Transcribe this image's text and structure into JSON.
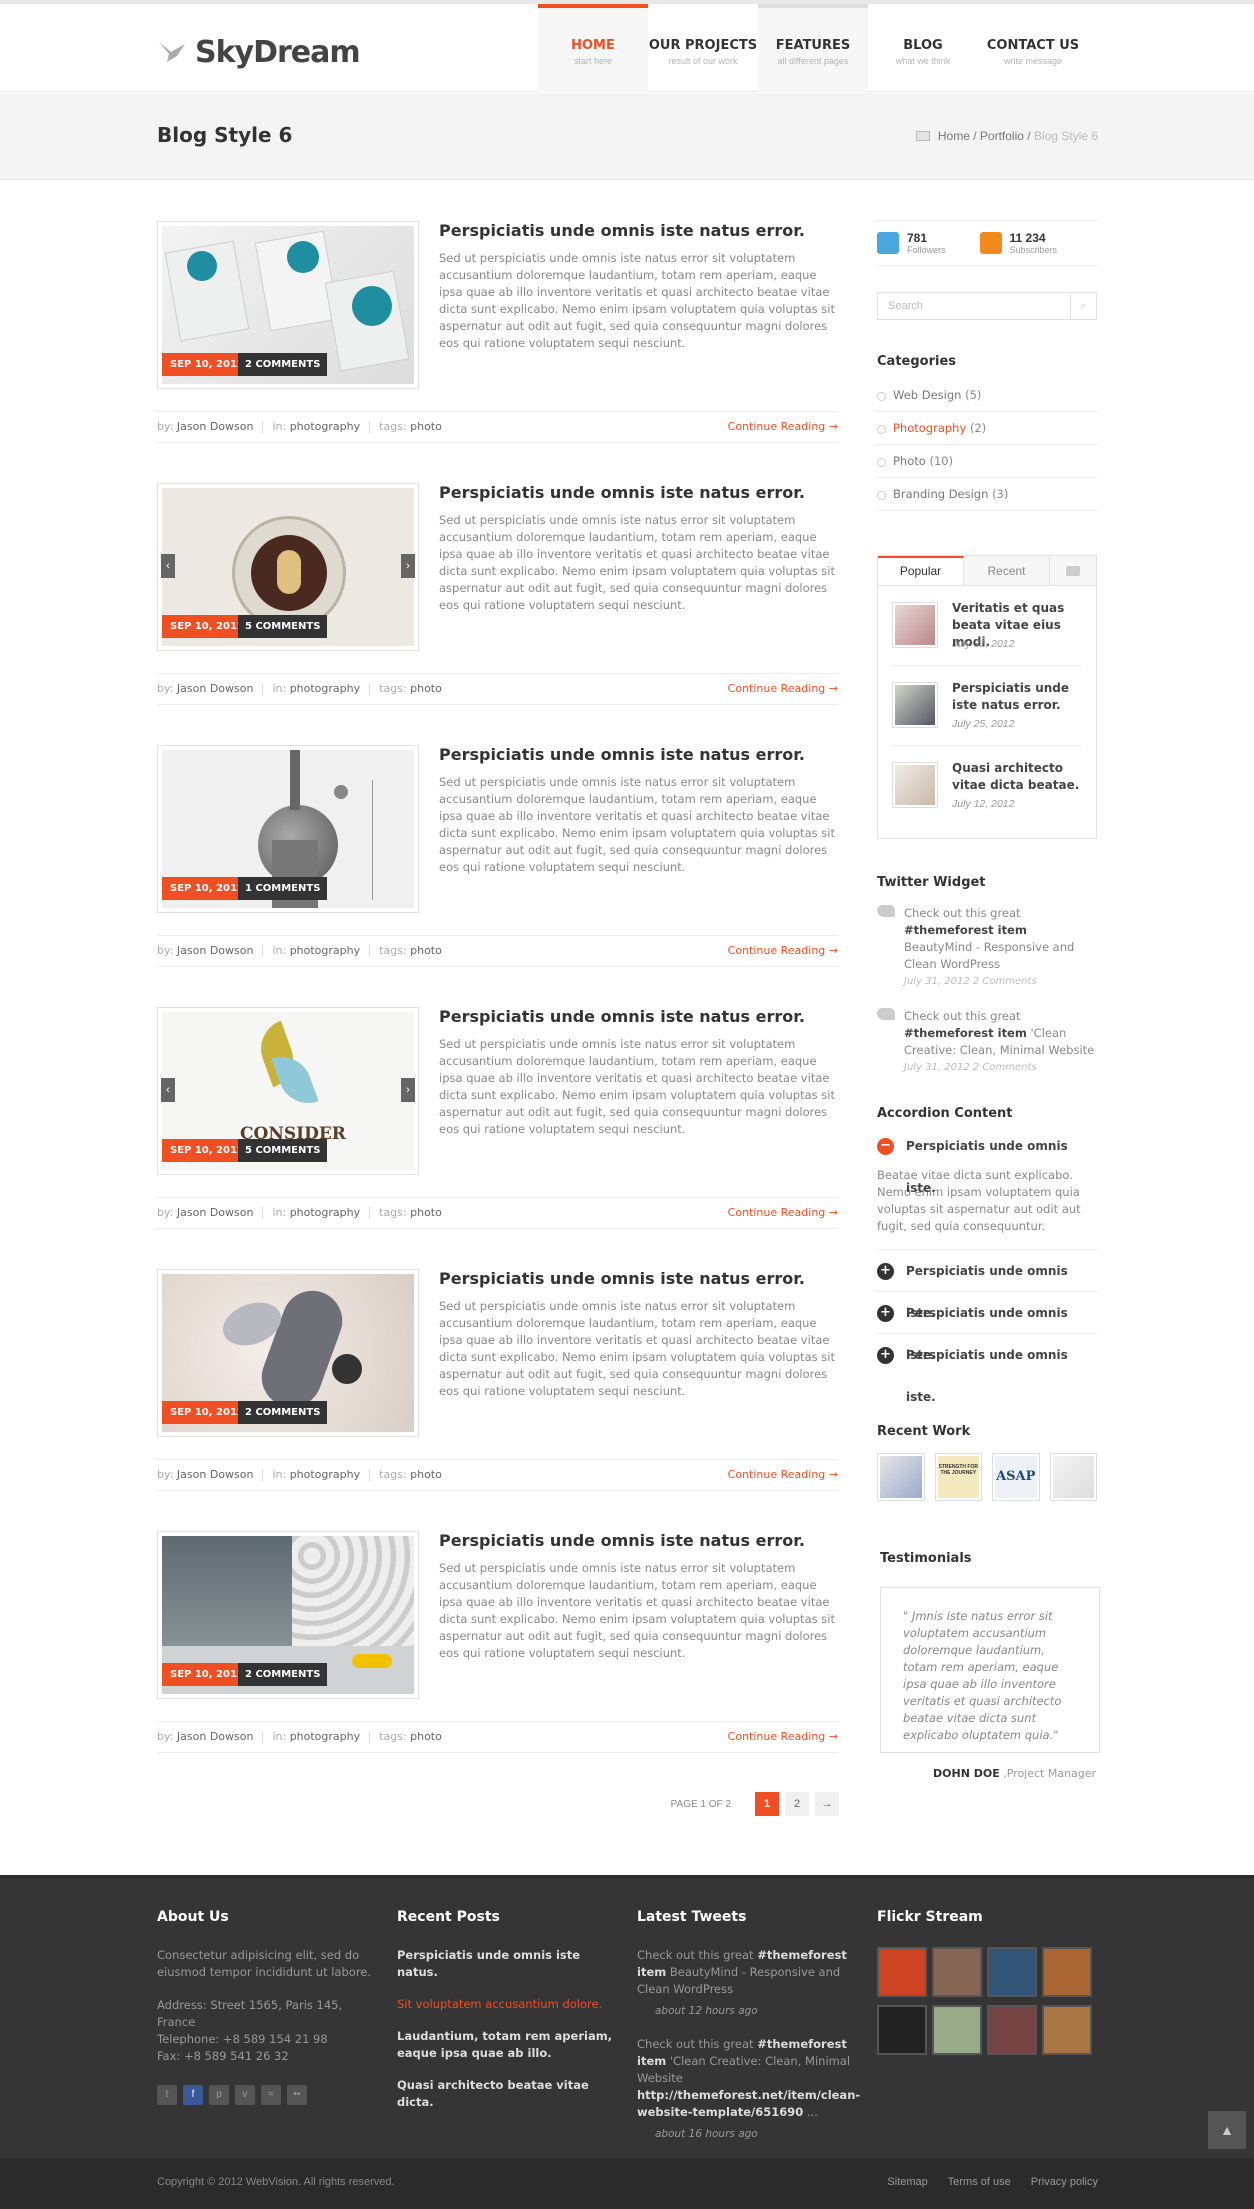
{
  "header": {
    "logo_text": "SkyDream",
    "nav": [
      {
        "label": "HOME",
        "sub": "start here"
      },
      {
        "label": "OUR PROJECTS",
        "sub": "result of our work"
      },
      {
        "label": "FEATURES",
        "sub": "all different pages"
      },
      {
        "label": "BLOG",
        "sub": "what we think"
      },
      {
        "label": "CONTACT US",
        "sub": "write message"
      }
    ]
  },
  "titlebar": {
    "title": "Blog Style 6",
    "crumb_home": "Home",
    "crumb_sep1": " / ",
    "crumb_portfolio": "Portfolio",
    "crumb_sep2": " / ",
    "crumb_current": "Blog Style 6"
  },
  "posts": [
    {
      "title": "Perspiciatis unde omnis iste natus error.",
      "date": "SEP 10, 2012",
      "comments": "2 COMMENTS",
      "text": "Sed ut perspiciatis unde omnis iste natus error sit voluptatem accusantium doloremque laudantium, totam rem aperiam, eaque ipsa quae ab illo inventore veritatis et quasi architecto beatae vitae dicta sunt explicabo. Nemo enim ipsam voluptatem quia voluptas sit aspernatur aut odit aut fugit, sed quia consequuntur magni dolores eos qui ratione voluptatem sequi nesciunt.",
      "author": "Jason Dowson",
      "category": "photography",
      "tag": "photo"
    },
    {
      "title": "Perspiciatis unde omnis iste natus error.",
      "date": "SEP 10, 2012",
      "comments": "5 COMMENTS",
      "text": "Sed ut perspiciatis unde omnis iste natus error sit voluptatem accusantium doloremque laudantium, totam rem aperiam, eaque ipsa quae ab illo inventore veritatis et quasi architecto beatae vitae dicta sunt explicabo. Nemo enim ipsam voluptatem quia voluptas sit aspernatur aut odit aut fugit, sed quia consequuntur magni dolores eos qui ratione voluptatem sequi nesciunt.",
      "author": "Jason Dowson",
      "category": "photography",
      "tag": "photo"
    },
    {
      "title": "Perspiciatis unde omnis iste natus error.",
      "date": "SEP 10, 2012",
      "comments": "1 COMMENTS",
      "text": "Sed ut perspiciatis unde omnis iste natus error sit voluptatem accusantium doloremque laudantium, totam rem aperiam, eaque ipsa quae ab illo inventore veritatis et quasi architecto beatae vitae dicta sunt explicabo. Nemo enim ipsam voluptatem quia voluptas sit aspernatur aut odit aut fugit, sed quia consequuntur magni dolores eos qui ratione voluptatem sequi nesciunt.",
      "author": "Jason Dowson",
      "category": "photography",
      "tag": "photo"
    },
    {
      "title": "Perspiciatis unde omnis iste natus error.",
      "date": "SEP 10, 2012",
      "comments": "5 COMMENTS",
      "text": "Sed ut perspiciatis unde omnis iste natus error sit voluptatem accusantium doloremque laudantium, totam rem aperiam, eaque ipsa quae ab illo inventore veritatis et quasi architecto beatae vitae dicta sunt explicabo. Nemo enim ipsam voluptatem quia voluptas sit aspernatur aut odit aut fugit, sed quia consequuntur magni dolores eos qui ratione voluptatem sequi nesciunt.",
      "author": "Jason Dowson",
      "category": "photography",
      "tag": "photo",
      "image_text": "CONSIDER"
    },
    {
      "title": "Perspiciatis unde omnis iste natus error.",
      "date": "SEP 10, 2012",
      "comments": "2 COMMENTS",
      "text": "Sed ut perspiciatis unde omnis iste natus error sit voluptatem accusantium doloremque laudantium, totam rem aperiam, eaque ipsa quae ab illo inventore veritatis et quasi architecto beatae vitae dicta sunt explicabo. Nemo enim ipsam voluptatem quia voluptas sit aspernatur aut odit aut fugit, sed quia consequuntur magni dolores eos qui ratione voluptatem sequi nesciunt.",
      "author": "Jason Dowson",
      "category": "photography",
      "tag": "photo"
    },
    {
      "title": "Perspiciatis unde omnis iste natus error.",
      "date": "SEP 10, 2012",
      "comments": "2 COMMENTS",
      "text": "Sed ut perspiciatis unde omnis iste natus error sit voluptatem accusantium doloremque laudantium, totam rem aperiam, eaque ipsa quae ab illo inventore veritatis et quasi architecto beatae vitae dicta sunt explicabo. Nemo enim ipsam voluptatem quia voluptas sit aspernatur aut odit aut fugit, sed quia consequuntur magni dolores eos qui ratione voluptatem sequi nesciunt.",
      "author": "Jason Dowson",
      "category": "photography",
      "tag": "photo"
    }
  ],
  "meta_labels": {
    "by": "by:",
    "in": "in:",
    "tags": "tags:",
    "continue": "Continue Reading →"
  },
  "pagination": {
    "label": "PAGE 1 OF 2",
    "pages": [
      "1",
      "2"
    ],
    "next": "→"
  },
  "sidebar": {
    "twitter": {
      "count": "781",
      "label": "Followers"
    },
    "rss": {
      "count": "11 234",
      "label": "Subscribers"
    },
    "search_placeholder": "Search",
    "categories_title": "Categories",
    "categories": [
      {
        "name": "Web Design",
        "count": "(5)"
      },
      {
        "name": "Photography",
        "count": "(2)"
      },
      {
        "name": "Photo",
        "count": "(10)"
      },
      {
        "name": "Branding Design",
        "count": "(3)"
      }
    ],
    "tabs": [
      "Popular",
      "Recent"
    ],
    "popular": [
      {
        "title": "Veritatis et quas beata vitae eius modi.",
        "date": "July 31, 2012"
      },
      {
        "title": "Perspiciatis unde iste natus error.",
        "date": "July 25, 2012"
      },
      {
        "title": "Quasi architecto vitae dicta beatae.",
        "date": "July 12, 2012"
      }
    ],
    "twitter_title": "Twitter Widget",
    "tweets": [
      {
        "pre": "Check out this great ",
        "bold": "#themeforest item",
        "post": " BeautyMind - Responsive and Clean WordPress",
        "when": "July 31, 2012 2 Comments"
      },
      {
        "pre": "Check out this great ",
        "bold": "#themeforest item",
        "post": " 'Clean Creative: Clean, Minimal Website",
        "when": "July 31, 2012 2 Comments"
      }
    ],
    "accordion_title": "Accordion Content",
    "accordion": [
      {
        "title": "Perspiciatis unde omnis iste.",
        "body": "Beatae vitae dicta sunt explicabo. Nemo enim ipsam voluptatem quia voluptas sit aspernatur aut odit aut fugit, sed quia consequuntur."
      },
      {
        "title": "Perspiciatis unde omnis iste."
      },
      {
        "title": "Perspiciatis unde omnis iste."
      },
      {
        "title": "Perspiciatis unde omnis iste."
      }
    ],
    "recent_work_title": "Recent Work",
    "recent_work_labels": [
      "STRENGTH FOR THE JOURNEY",
      "ASAP"
    ],
    "testimonials_title": "Testimonials",
    "testimonial": {
      "text": "\" Jmnis iste natus error sit voluptatem accusantium doloremque laudantium, totam rem aperiam, eaque ipsa quae ab illo inventore veritatis et quasi architecto beatae vitae dicta sunt explicabo oluptatem quia.\"",
      "name": "DOHN DOE",
      "role": ",Project Manager"
    }
  },
  "footer": {
    "about_title": "About Us",
    "about_text": "Consectetur adipisicing elit, sed do eiusmod tempor incididunt ut labore.",
    "address": "Address: Street 1565, Paris 145, France",
    "phone": "Telephone: +8 589 154 21 98",
    "fax": "Fax: +8 589 541 26 32",
    "recent_title": "Recent Posts",
    "recent": [
      "Perspiciatis unde omnis iste natus.",
      "Sit voluptatem accusantium dolore.",
      "Laudantium, totam rem aperiam, eaque ipsa quae ab illo.",
      "Quasi architecto beatae vitae dicta."
    ],
    "tweets_title": "Latest Tweets",
    "tweets": [
      {
        "pre": "Check out this great ",
        "bold": "#themeforest item",
        "post": " BeautyMind - Responsive and Clean WordPress",
        "when": "about 12 hours ago"
      },
      {
        "pre": "Check out this great ",
        "bold": "#themeforest item",
        "post": " 'Clean Creative: Clean, Minimal Website ",
        "link": "http://themeforest.net/item/clean-website-template/651690",
        "tail": " ...",
        "when": "about 16 hours ago"
      }
    ],
    "flickr_title": "Flickr Stream",
    "copyright": "Copyright © 2012 WebVision. All rights reserved.",
    "links": [
      "Sitemap",
      "Terms of use",
      "Privacy policy"
    ]
  },
  "colors": {
    "accent": "#f04e23",
    "dark": "#353535"
  }
}
